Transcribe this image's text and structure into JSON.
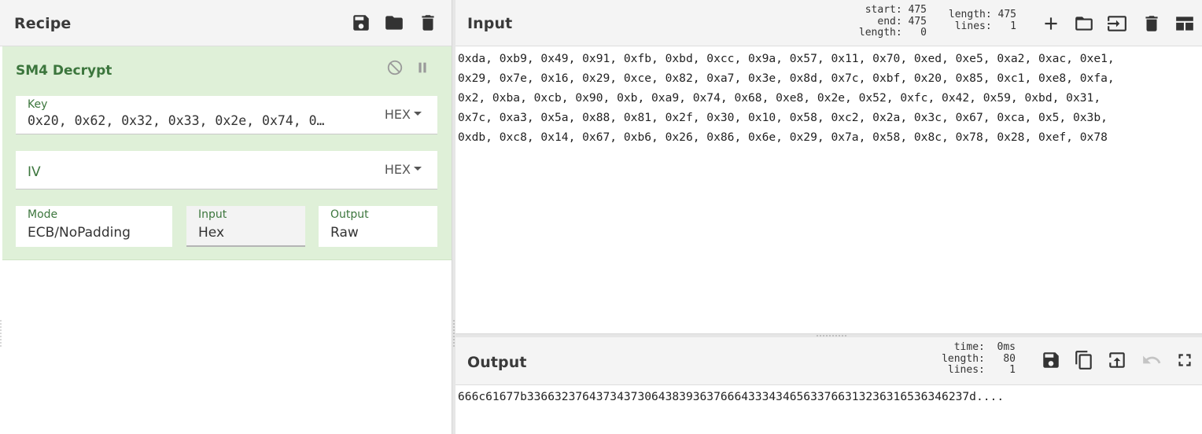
{
  "recipe": {
    "title": "Recipe",
    "icons": [
      "save-icon",
      "folder-icon",
      "trash-icon"
    ],
    "operation": {
      "name": "SM4 Decrypt",
      "key": {
        "label": "Key",
        "value": "0x20, 0x62, 0x32, 0x33, 0x2e, 0x74, 0…",
        "format": "HEX"
      },
      "iv": {
        "label": "IV",
        "value": "",
        "format": "HEX"
      },
      "mode": {
        "label": "Mode",
        "value": "ECB/NoPadding"
      },
      "input": {
        "label": "Input",
        "value": "Hex"
      },
      "output": {
        "label": "Output",
        "value": "Raw"
      }
    }
  },
  "input": {
    "title": "Input",
    "stats_left": "start: 475\n  end: 475\nlength:   0",
    "stats_right": "length: 475\n lines:   1",
    "text": "0xda, 0xb9, 0x49, 0x91, 0xfb, 0xbd, 0xcc, 0x9a, 0x57, 0x11, 0x70, 0xed, 0xe5, 0xa2, 0xac, 0xe1,\n0x29, 0x7e, 0x16, 0x29, 0xce, 0x82, 0xa7, 0x3e, 0x8d, 0x7c, 0xbf, 0x20, 0x85, 0xc1, 0xe8, 0xfa,\n0x2, 0xba, 0xcb, 0x90, 0xb, 0xa9, 0x74, 0x68, 0xe8, 0x2e, 0x52, 0xfc, 0x42, 0x59, 0xbd, 0x31,\n0x7c, 0xa3, 0x5a, 0x88, 0x81, 0x2f, 0x30, 0x10, 0x58, 0xc2, 0x2a, 0x3c, 0x67, 0xca, 0x5, 0x3b,\n0xdb, 0xc8, 0x14, 0x67, 0xb6, 0x26, 0x86, 0x6e, 0x29, 0x7a, 0x58, 0x8c, 0x78, 0x28, 0xef, 0x78"
  },
  "output": {
    "title": "Output",
    "stats": "  time:  0ms\nlength:   80\n lines:    1",
    "text": "666c61677b3366323764373437306438393637666433343465633766313236316536346237d...."
  }
}
